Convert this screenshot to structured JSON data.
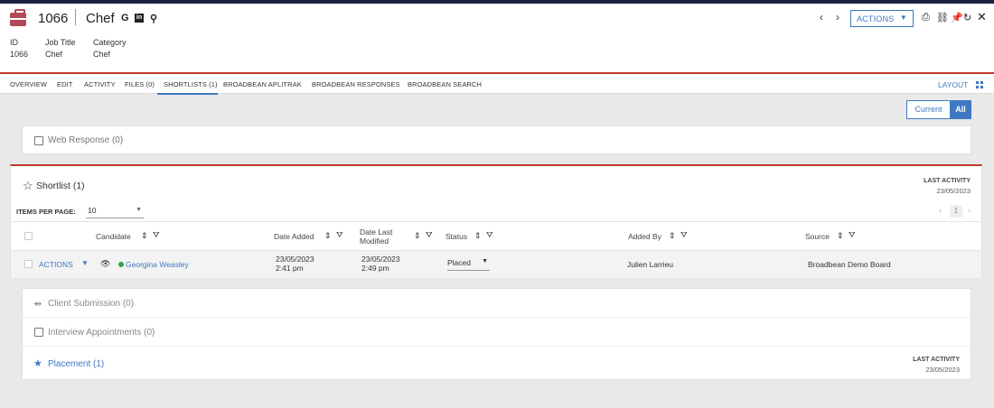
{
  "header": {
    "record_id": "1066",
    "record_title": "Chef",
    "social": {
      "google": "G",
      "linkedin": "in",
      "location": "⚲"
    },
    "meta": [
      {
        "label": "ID",
        "value": "1066"
      },
      {
        "label": "Job Title",
        "value": "Chef"
      },
      {
        "label": "Category",
        "value": "Chef"
      }
    ],
    "actions_label": "ACTIONS",
    "prev_icon": "‹",
    "next_icon": "›"
  },
  "tabs": [
    {
      "label": "OVERVIEW"
    },
    {
      "label": "EDIT"
    },
    {
      "label": "ACTIVITY"
    },
    {
      "label": "FILES (0)"
    },
    {
      "label": "SHORTLISTS (1)",
      "active": true
    },
    {
      "label": "BROADBEAN APLITRAK"
    },
    {
      "label": "BROADBEAN RESPONSES"
    },
    {
      "label": "BROADBEAN SEARCH"
    }
  ],
  "layout_label": "LAYOUT",
  "toggle": {
    "current": "Current",
    "all": "All"
  },
  "web_response": {
    "label": "Web Response (0)"
  },
  "shortlist": {
    "title": "Shortlist (1)",
    "last_activity_label": "LAST ACTIVITY",
    "last_activity_value": "23/05/2023",
    "items_per_page_label": "ITEMS PER PAGE:",
    "items_per_page_value": "10",
    "page_number": "1",
    "columns": {
      "candidate": "Candidate",
      "date_added": "Date Added",
      "date_modified_1": "Date Last",
      "date_modified_2": "Modified",
      "status": "Status",
      "added_by": "Added By",
      "source": "Source"
    },
    "row": {
      "actions": "ACTIONS",
      "candidate": "Georgina Weasley",
      "date_added_date": "23/05/2023",
      "date_added_time": "2:41 pm",
      "date_modified_date": "23/05/2023",
      "date_modified_time": "2:49 pm",
      "status": "Placed",
      "added_by": "Julien Larrieu",
      "source": "Broadbean Demo Board"
    }
  },
  "sections": {
    "client_submission": "Client Submission (0)",
    "interview": "Interview Appointments (0)",
    "placement": "Placement (1)",
    "placement_last_activity_label": "LAST ACTIVITY",
    "placement_last_activity_value": "23/05/2023"
  },
  "colors": {
    "accent": "#3f78c2",
    "brand": "#b24a56",
    "divider": "#c0392b",
    "status_green": "#2ea34a"
  }
}
